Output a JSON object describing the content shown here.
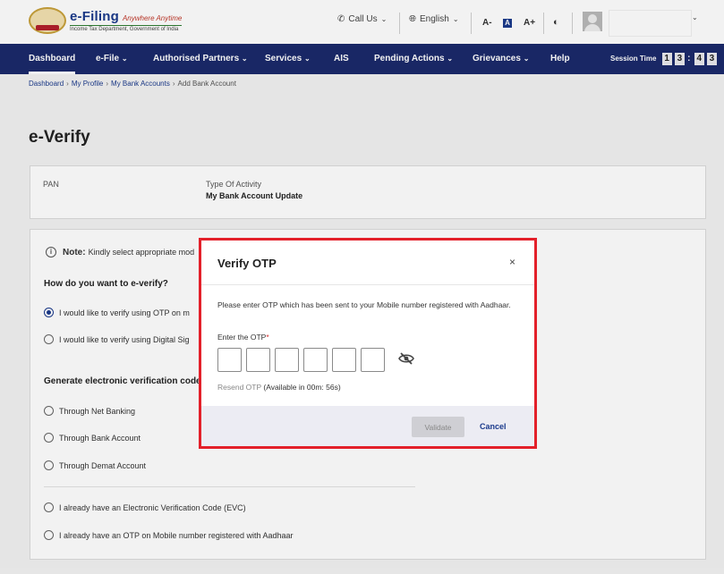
{
  "header": {
    "brand_name": "e-Filing",
    "brand_tagline": "Anywhere Anytime",
    "brand_subtitle": "Income Tax Department, Government of India",
    "call_us": "Call Us",
    "language": "English",
    "font_decrease": "A-",
    "font_normal": "A",
    "font_increase": "A+"
  },
  "nav": {
    "items": [
      "Dashboard",
      "e-File",
      "Authorised Partners",
      "Services",
      "AIS",
      "Pending Actions",
      "Grievances",
      "Help"
    ],
    "session_label": "Session Time",
    "session_digits": [
      "1",
      "3",
      "4",
      "3"
    ]
  },
  "breadcrumb": {
    "items": [
      "Dashboard",
      "My Profile",
      "My Bank Accounts"
    ],
    "current": "Add Bank Account"
  },
  "page": {
    "title": "e-Verify",
    "pan_label": "PAN",
    "activity_label": "Type Of Activity",
    "activity_value": "My Bank Account Update"
  },
  "verify": {
    "note_label": "Note:",
    "note_text": "Kindly select appropriate mod",
    "question": "How do you want to e-verify?",
    "options": [
      "I would like to verify using OTP on m",
      "I would like to verify using Digital Sig"
    ],
    "evc_title": "Generate electronic verification code",
    "evc_options": [
      "Through Net Banking",
      "Through Bank Account",
      "Through Demat Account"
    ],
    "other_options": [
      "I already have an Electronic Verification Code (EVC)",
      "I already have an OTP on Mobile number registered with Aadhaar"
    ]
  },
  "modal": {
    "title": "Verify OTP",
    "close": "×",
    "message": "Please enter OTP which has been sent to your Mobile number registered with Aadhaar.",
    "otp_label": "Enter the OTP",
    "required_mark": "*",
    "resend_label": "Resend OTP",
    "resend_time": "(Available in  00m: 56s)",
    "validate_label": "Validate",
    "cancel_label": "Cancel"
  },
  "colors": {
    "nav_bg": "#1b2a6b",
    "accent": "#1b3a8c",
    "highlight_border": "#e3202a"
  }
}
